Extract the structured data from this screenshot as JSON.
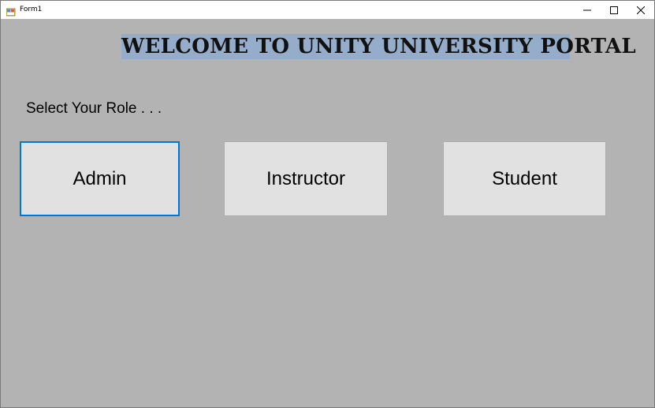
{
  "window": {
    "title": "Form1"
  },
  "header": {
    "welcome_text": "WELCOME TO UNITY UNIVERSITY PORTAL"
  },
  "main": {
    "select_label": "Select Your Role . . .",
    "roles": [
      {
        "label": "Admin"
      },
      {
        "label": "Instructor"
      },
      {
        "label": "Student"
      }
    ]
  },
  "colors": {
    "form_background": "#b3b3b3",
    "banner_background": "#95adca",
    "button_face": "#e1e1e1",
    "focus_border": "#0078d7"
  },
  "icons": {
    "app": "winforms-app-icon",
    "minimize": "minimize-icon",
    "maximize": "maximize-icon",
    "close": "close-icon"
  }
}
